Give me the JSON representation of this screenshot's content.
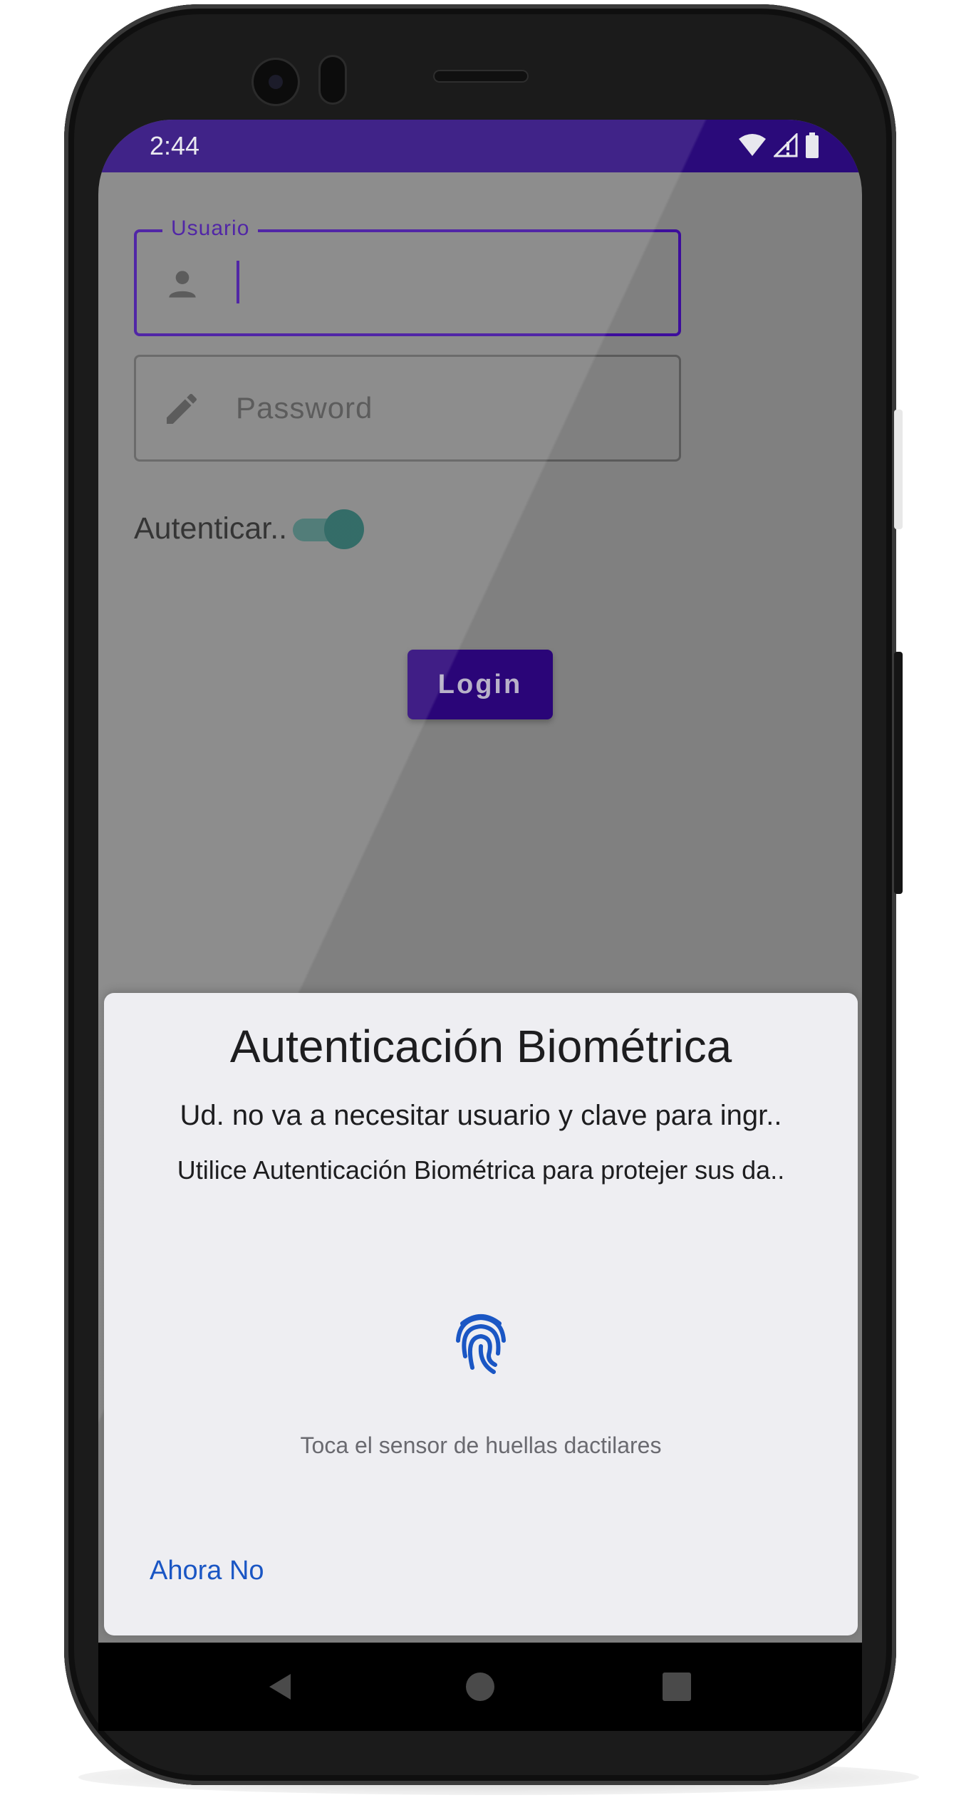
{
  "status_bar": {
    "time": "2:44",
    "icons": [
      "wifi-icon",
      "signal-icon",
      "battery-icon"
    ]
  },
  "form": {
    "user_field": {
      "label": "Usuario",
      "icon": "person-icon",
      "value": ""
    },
    "password_field": {
      "placeholder": "Password",
      "icon": "pencil-icon",
      "value": ""
    },
    "switch": {
      "label": "Autenticar..",
      "checked": true
    },
    "login_label": "Login"
  },
  "dialog": {
    "title": "Autenticación Biométrica",
    "subtitle": "Ud. no va a necesitar usuario y clave para ingr..",
    "description": "Utilice Autenticación Biométrica para protejer sus da..",
    "icon": "fingerprint-icon",
    "hint": "Toca el sensor de huellas dactilares",
    "negative_button": "Ahora No"
  },
  "nav_bar": {
    "buttons": [
      "back-icon",
      "home-icon",
      "recents-icon"
    ]
  },
  "colors": {
    "primary": "#3d0d9c",
    "status_bar": "#2a0a7a",
    "accent_teal": "#1d5c57",
    "link_blue": "#1a56c4",
    "dialog_bg": "#eeeef2"
  }
}
